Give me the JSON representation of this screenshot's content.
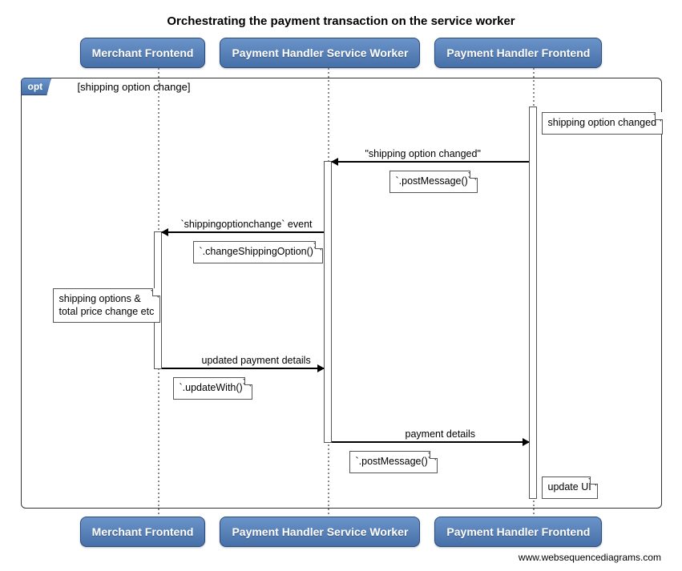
{
  "title": "Orchestrating the payment transaction on the service worker",
  "participants": {
    "p1": "Merchant Frontend",
    "p2": "Payment Handler Service Worker",
    "p3": "Payment Handler Frontend"
  },
  "frame": {
    "tag": "opt",
    "guard": "[shipping option change]"
  },
  "notes": {
    "n1": "shipping option changed",
    "n2": "`.postMessage()`",
    "n3": "`.changeShippingOption()`",
    "n4_line1": "shipping options &",
    "n4_line2": "total price change etc",
    "n5": "`.updateWith()`",
    "n6": "`.postMessage()`",
    "n7": "update UI"
  },
  "messages": {
    "m1": "\"shipping option changed\"",
    "m2": "`shippingoptionchange` event",
    "m3": "updated payment details",
    "m4": "payment details"
  },
  "credit": "www.websequencediagrams.com",
  "chart_data": {
    "type": "sequence-diagram",
    "title": "Orchestrating the payment transaction on the service worker",
    "participants": [
      "Merchant Frontend",
      "Payment Handler Service Worker",
      "Payment Handler Frontend"
    ],
    "fragments": [
      {
        "type": "opt",
        "guard": "shipping option change",
        "steps": [
          {
            "type": "note",
            "over": "Payment Handler Frontend",
            "text": "shipping option changed"
          },
          {
            "type": "message",
            "from": "Payment Handler Frontend",
            "to": "Payment Handler Service Worker",
            "label": "\"shipping option changed\"",
            "note": "`.postMessage()`"
          },
          {
            "type": "message",
            "from": "Payment Handler Service Worker",
            "to": "Merchant Frontend",
            "label": "`shippingoptionchange` event",
            "note": "`.changeShippingOption()`"
          },
          {
            "type": "note",
            "over": "Merchant Frontend",
            "text": "shipping options & total price change etc"
          },
          {
            "type": "message",
            "from": "Merchant Frontend",
            "to": "Payment Handler Service Worker",
            "label": "updated payment details",
            "note": "`.updateWith()`"
          },
          {
            "type": "message",
            "from": "Payment Handler Service Worker",
            "to": "Payment Handler Frontend",
            "label": "payment details",
            "note": "`.postMessage()`"
          },
          {
            "type": "note",
            "over": "Payment Handler Frontend",
            "text": "update UI"
          }
        ]
      }
    ]
  }
}
